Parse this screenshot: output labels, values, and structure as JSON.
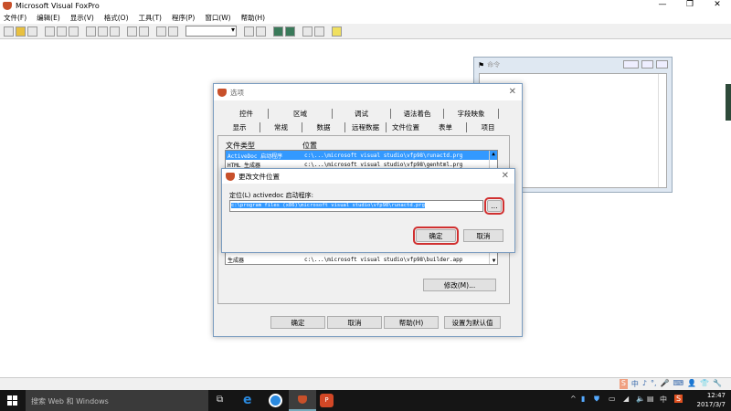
{
  "app": {
    "title": "Microsoft Visual FoxPro"
  },
  "menu": [
    "文件(F)",
    "编辑(E)",
    "显示(V)",
    "格式(O)",
    "工具(T)",
    "程序(P)",
    "窗口(W)",
    "帮助(H)"
  ],
  "command_window": {
    "title": "命令"
  },
  "options_dialog": {
    "title": "选项",
    "tabs_row1": [
      "控件",
      "区域",
      "调试",
      "语法着色",
      "字段映象"
    ],
    "tabs_row2": [
      "显示",
      "常规",
      "数据",
      "远程数据",
      "文件位置",
      "表单",
      "项目"
    ],
    "active_tab": "文件位置",
    "col_type": "文件类型",
    "col_location": "位置",
    "rows": [
      {
        "type": "ActiveDoc 启动程序",
        "location": "c:\\...\\microsoft visual studio\\vfp98\\runactd.prg"
      },
      {
        "type": "HTML 生成器",
        "location": "c:\\...\\microsoft visual studio\\vfp98\\genhtml.prg"
      },
      {
        "type": "生成器",
        "location": "c:\\...\\microsoft visual studio\\vfp98\\builder.app"
      }
    ],
    "modify": "修改(M)...",
    "ok": "确定",
    "cancel": "取消",
    "help": "帮助(H)",
    "set_default": "设置为默认值"
  },
  "change_dialog": {
    "title": "更改文件位置",
    "label": "定位(L) activedoc 启动程序:",
    "value": "c:\\program files (x86)\\microsoft visual studio\\vfp98\\runactd.prg",
    "browse": "...",
    "ok": "确定",
    "cancel": "取消"
  },
  "taskbar": {
    "search": "搜索 Web 和 Windows",
    "time": "12:47",
    "date": "2017/3/7",
    "ime": "中"
  }
}
